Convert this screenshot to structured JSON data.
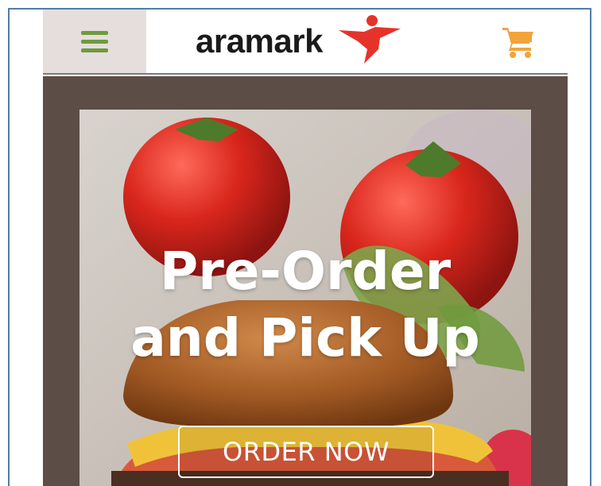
{
  "header": {
    "logo_text": "aramark",
    "menu_icon": "hamburger-icon",
    "cart_icon": "shopping-cart-icon"
  },
  "hero": {
    "title_line1": "Pre-Order",
    "title_line2": "and Pick Up",
    "button_label": "ORDER NOW"
  },
  "colors": {
    "accent_green": "#6f9a3c",
    "cart_orange": "#f2a33a",
    "logo_red": "#e5332a",
    "hero_frame": "#5d4d47",
    "menu_bg": "#e6dedd",
    "border_blue": "#4d7fa9"
  }
}
